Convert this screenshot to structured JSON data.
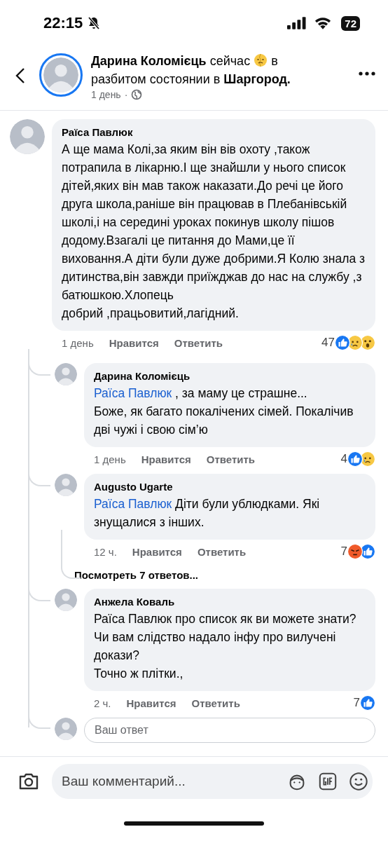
{
  "status_bar": {
    "time": "22:15",
    "muted": true,
    "battery": "72"
  },
  "post_header": {
    "author": "Дарина Коломієць",
    "activity": "сейчас",
    "feeling_start": "в",
    "feeling": "разбитом состоянии в **Шаргород.**",
    "time": "1 день",
    "separator": "·",
    "story_ring": true
  },
  "comment": {
    "author": "Раїса Павлюк",
    "parts": [
      {
        "kind": "text",
        "text": "А ще мама Колі,за яким він вів охоту ,також потрапила в лікарню.І ще знайшли у нього список дітей,яких він мав також наказати.До речі це його друга школа,раніше він працював в Плебанівській школі,і на середині уроках покинув школу пішов додому.Взагалі це питання до Мами,це її виховання.А діти були дуже добрими.Я Колю знала з дитинства,він завжди приїжджав до нас на службу ,з батюшкою.Хлопець\nдобрий ,працьовитий,лагідний."
      }
    ],
    "time": "1 день",
    "like": "Нравится",
    "reply": "Ответить",
    "count": "47",
    "reactions": [
      {
        "kind": "like"
      },
      {
        "kind": "sad"
      },
      {
        "kind": "wow"
      }
    ],
    "replies": [
      {
        "author": "Дарина Коломієць",
        "parts": [
          {
            "kind": "mention",
            "text": "Раїса Павлюк"
          },
          {
            "kind": "text",
            "text": " , за маму це страшне...\nБоже, як багато покалічених сімей. Покалічив дві чужі і свою сім’ю"
          }
        ],
        "time": "1 день",
        "like": "Нравится",
        "reply": "Ответить",
        "count": "4",
        "reactions": [
          {
            "kind": "like"
          },
          {
            "kind": "sad"
          }
        ]
      },
      {
        "author": "Augusto Ugarte",
        "parts": [
          {
            "kind": "mention",
            "text": "Раїса Павлюк"
          },
          {
            "kind": "text",
            "text": " Діти були ублюдками. Які знущалися з інших."
          }
        ],
        "time": "12 ч.",
        "like": "Нравится",
        "reply": "Ответить",
        "count": "7",
        "reactions": [
          {
            "kind": "angry"
          },
          {
            "kind": "like"
          }
        ],
        "more_replies": "Посмотреть 7 ответов..."
      },
      {
        "author": "Анжела Коваль",
        "parts": [
          {
            "kind": "text",
            "text": "Раїса Павлюк про список як ви можете знати? Чи вам слідство надало інфу про вилучені докази?\nТочно ж плітки.,"
          }
        ],
        "time": "2 ч.",
        "like": "Нравится",
        "reply": "Ответить",
        "count": "7",
        "reactions": [
          {
            "kind": "like"
          }
        ]
      }
    ],
    "reply_field": {
      "placeholder": "Ваш ответ"
    }
  },
  "composer": {
    "placeholder": "Ваш комментарий..."
  }
}
